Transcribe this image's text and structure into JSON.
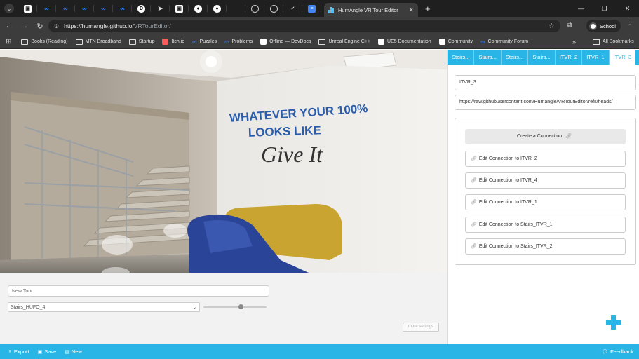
{
  "browser": {
    "active_tab_title": "HumAngle VR Tour Editor",
    "url_host": "https://humangle.github.io",
    "url_path": "/VRTourEditor/",
    "profile_name": "School",
    "pinned_tabs": [
      "hashnode-icon",
      "meta-icon",
      "meta-icon",
      "meta-icon",
      "meta-icon",
      "meta-icon",
      "d-icon",
      "send-icon",
      "hashnode-icon",
      "github-icon",
      "github-icon",
      "blank-icon",
      "globe-icon",
      "globe-icon",
      "check-icon",
      "docs-icon"
    ]
  },
  "bookmarks": {
    "items": [
      {
        "label": "Books (Reading)",
        "icon": "folder-icon"
      },
      {
        "label": "MTN Broadband",
        "icon": "folder-icon"
      },
      {
        "label": "Startup",
        "icon": "folder-icon"
      },
      {
        "label": "Itch.io",
        "icon": "itch-icon"
      },
      {
        "label": "Puzzles",
        "icon": "meta-icon"
      },
      {
        "label": "Problems",
        "icon": "meta-icon"
      },
      {
        "label": "Offline — DevDocs",
        "icon": "devdocs-icon"
      },
      {
        "label": "Unreal Engine C++",
        "icon": "folder-icon"
      },
      {
        "label": "UE5 Documentation",
        "icon": "ue-icon"
      },
      {
        "label": "Community",
        "icon": "ue-icon"
      },
      {
        "label": "Community Forum",
        "icon": "meta-icon"
      }
    ],
    "more": "»",
    "all_label": "All Bookmarks"
  },
  "viewer": {
    "wall_line1": "WHATEVER YOUR 100%",
    "wall_line2": "LOOKS LIKE",
    "wall_line3": "Give It"
  },
  "controls": {
    "tour_name_placeholder": "New Tour",
    "scene_selected": "Stairs_HUFO_4",
    "slider_value_fraction": 0.6,
    "more_settings_label": "more settings"
  },
  "panel": {
    "tabs": [
      {
        "label": "Stairs...",
        "active": false
      },
      {
        "label": "Stairs...",
        "active": false
      },
      {
        "label": "Stairs...",
        "active": false
      },
      {
        "label": "Stairs...",
        "active": false
      },
      {
        "label": "ITVR_2",
        "active": false
      },
      {
        "label": "ITVR_1",
        "active": false
      },
      {
        "label": "ITVR_3",
        "active": true
      }
    ],
    "scene_name": "ITVR_3",
    "image_url": "https://raw.githubusercontent.com/Humangle/VRTourEditor/refs/heads/",
    "create_connection_label": "Create a Connection",
    "connections": [
      "Edit Connection to ITVR_2",
      "Edit Connection to ITVR_4",
      "Edit Connection to ITVR_1",
      "Edit Connection to Stairs_ITVR_1",
      "Edit Connection to Stairs_ITVR_2"
    ]
  },
  "footer": {
    "export_label": "Export",
    "save_label": "Save",
    "new_label": "New",
    "feedback_label": "Feedback"
  },
  "colors": {
    "accent": "#29b6e6",
    "chrome_dark": "#1f1f1f",
    "chrome_mid": "#3c3c3c"
  }
}
